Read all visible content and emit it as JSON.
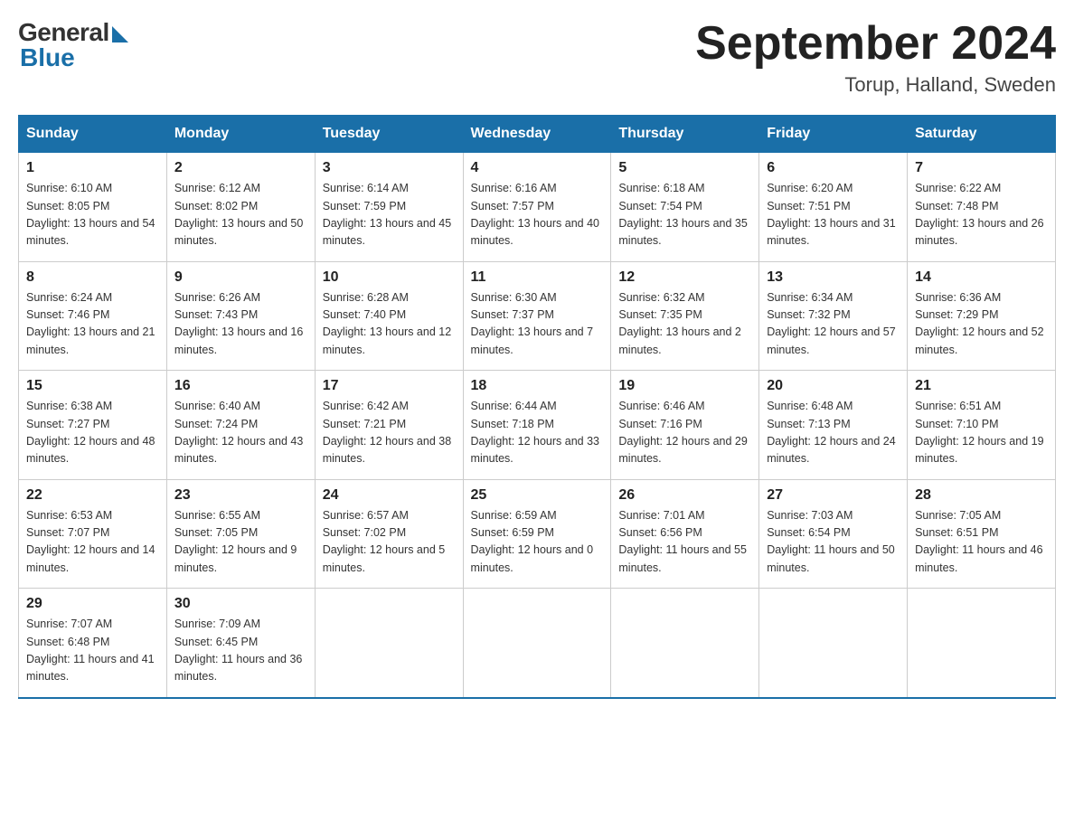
{
  "header": {
    "logo_general": "General",
    "logo_blue": "Blue",
    "month_title": "September 2024",
    "location": "Torup, Halland, Sweden"
  },
  "weekdays": [
    "Sunday",
    "Monday",
    "Tuesday",
    "Wednesday",
    "Thursday",
    "Friday",
    "Saturday"
  ],
  "weeks": [
    [
      {
        "day": "1",
        "sunrise": "6:10 AM",
        "sunset": "8:05 PM",
        "daylight": "13 hours and 54 minutes."
      },
      {
        "day": "2",
        "sunrise": "6:12 AM",
        "sunset": "8:02 PM",
        "daylight": "13 hours and 50 minutes."
      },
      {
        "day": "3",
        "sunrise": "6:14 AM",
        "sunset": "7:59 PM",
        "daylight": "13 hours and 45 minutes."
      },
      {
        "day": "4",
        "sunrise": "6:16 AM",
        "sunset": "7:57 PM",
        "daylight": "13 hours and 40 minutes."
      },
      {
        "day": "5",
        "sunrise": "6:18 AM",
        "sunset": "7:54 PM",
        "daylight": "13 hours and 35 minutes."
      },
      {
        "day": "6",
        "sunrise": "6:20 AM",
        "sunset": "7:51 PM",
        "daylight": "13 hours and 31 minutes."
      },
      {
        "day": "7",
        "sunrise": "6:22 AM",
        "sunset": "7:48 PM",
        "daylight": "13 hours and 26 minutes."
      }
    ],
    [
      {
        "day": "8",
        "sunrise": "6:24 AM",
        "sunset": "7:46 PM",
        "daylight": "13 hours and 21 minutes."
      },
      {
        "day": "9",
        "sunrise": "6:26 AM",
        "sunset": "7:43 PM",
        "daylight": "13 hours and 16 minutes."
      },
      {
        "day": "10",
        "sunrise": "6:28 AM",
        "sunset": "7:40 PM",
        "daylight": "13 hours and 12 minutes."
      },
      {
        "day": "11",
        "sunrise": "6:30 AM",
        "sunset": "7:37 PM",
        "daylight": "13 hours and 7 minutes."
      },
      {
        "day": "12",
        "sunrise": "6:32 AM",
        "sunset": "7:35 PM",
        "daylight": "13 hours and 2 minutes."
      },
      {
        "day": "13",
        "sunrise": "6:34 AM",
        "sunset": "7:32 PM",
        "daylight": "12 hours and 57 minutes."
      },
      {
        "day": "14",
        "sunrise": "6:36 AM",
        "sunset": "7:29 PM",
        "daylight": "12 hours and 52 minutes."
      }
    ],
    [
      {
        "day": "15",
        "sunrise": "6:38 AM",
        "sunset": "7:27 PM",
        "daylight": "12 hours and 48 minutes."
      },
      {
        "day": "16",
        "sunrise": "6:40 AM",
        "sunset": "7:24 PM",
        "daylight": "12 hours and 43 minutes."
      },
      {
        "day": "17",
        "sunrise": "6:42 AM",
        "sunset": "7:21 PM",
        "daylight": "12 hours and 38 minutes."
      },
      {
        "day": "18",
        "sunrise": "6:44 AM",
        "sunset": "7:18 PM",
        "daylight": "12 hours and 33 minutes."
      },
      {
        "day": "19",
        "sunrise": "6:46 AM",
        "sunset": "7:16 PM",
        "daylight": "12 hours and 29 minutes."
      },
      {
        "day": "20",
        "sunrise": "6:48 AM",
        "sunset": "7:13 PM",
        "daylight": "12 hours and 24 minutes."
      },
      {
        "day": "21",
        "sunrise": "6:51 AM",
        "sunset": "7:10 PM",
        "daylight": "12 hours and 19 minutes."
      }
    ],
    [
      {
        "day": "22",
        "sunrise": "6:53 AM",
        "sunset": "7:07 PM",
        "daylight": "12 hours and 14 minutes."
      },
      {
        "day": "23",
        "sunrise": "6:55 AM",
        "sunset": "7:05 PM",
        "daylight": "12 hours and 9 minutes."
      },
      {
        "day": "24",
        "sunrise": "6:57 AM",
        "sunset": "7:02 PM",
        "daylight": "12 hours and 5 minutes."
      },
      {
        "day": "25",
        "sunrise": "6:59 AM",
        "sunset": "6:59 PM",
        "daylight": "12 hours and 0 minutes."
      },
      {
        "day": "26",
        "sunrise": "7:01 AM",
        "sunset": "6:56 PM",
        "daylight": "11 hours and 55 minutes."
      },
      {
        "day": "27",
        "sunrise": "7:03 AM",
        "sunset": "6:54 PM",
        "daylight": "11 hours and 50 minutes."
      },
      {
        "day": "28",
        "sunrise": "7:05 AM",
        "sunset": "6:51 PM",
        "daylight": "11 hours and 46 minutes."
      }
    ],
    [
      {
        "day": "29",
        "sunrise": "7:07 AM",
        "sunset": "6:48 PM",
        "daylight": "11 hours and 41 minutes."
      },
      {
        "day": "30",
        "sunrise": "7:09 AM",
        "sunset": "6:45 PM",
        "daylight": "11 hours and 36 minutes."
      },
      null,
      null,
      null,
      null,
      null
    ]
  ]
}
